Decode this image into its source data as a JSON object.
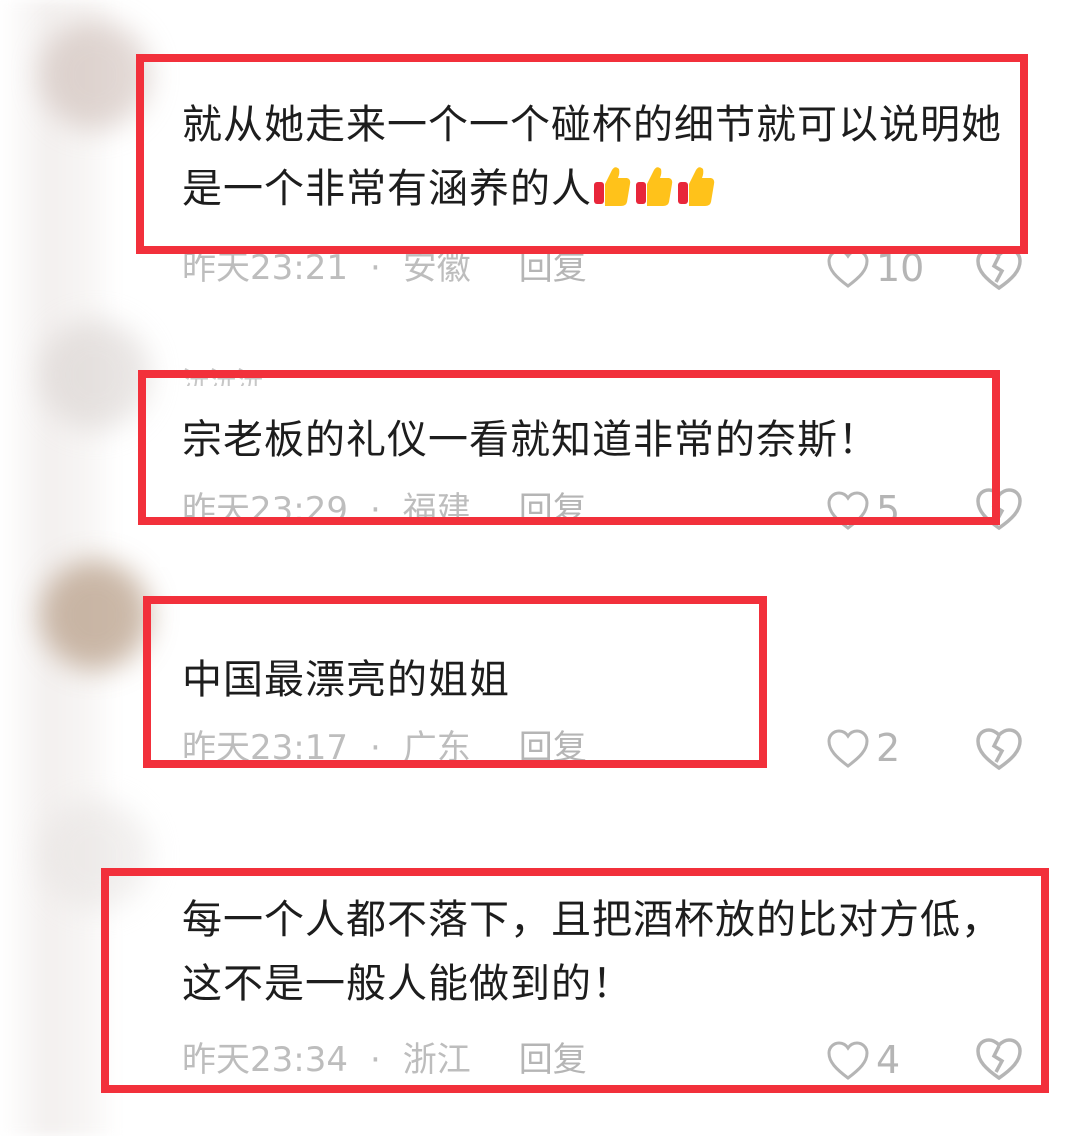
{
  "comments": [
    {
      "username": "",
      "text": "就从她走来一个一个碰杯的细节就可以说明她是一个非常有涵养的人",
      "emoji": [
        "thumbs-up",
        "thumbs-up",
        "thumbs-up"
      ],
      "time": "昨天23:21",
      "location": "安徽",
      "reply_label": "回复",
      "likes": "10"
    },
    {
      "username": "沅沅沅",
      "text": "宗老板的礼仪一看就知道非常的奈斯！",
      "time": "昨天23:29",
      "location": "福建",
      "reply_label": "回复",
      "likes": "5"
    },
    {
      "username": "",
      "text": "中国最漂亮的姐姐",
      "time": "昨天23:17",
      "location": "广东",
      "reply_label": "回复",
      "likes": "2"
    },
    {
      "username": "",
      "text": "每一个人都不落下，且把酒杯放的比对方低，这不是一般人能做到的！",
      "time": "昨天23:34",
      "location": "浙江",
      "reply_label": "回复",
      "likes": "4"
    }
  ],
  "colors": {
    "highlight_border": "#f2303b",
    "text": "#1d1d1d",
    "meta": "#bdbdbd"
  }
}
